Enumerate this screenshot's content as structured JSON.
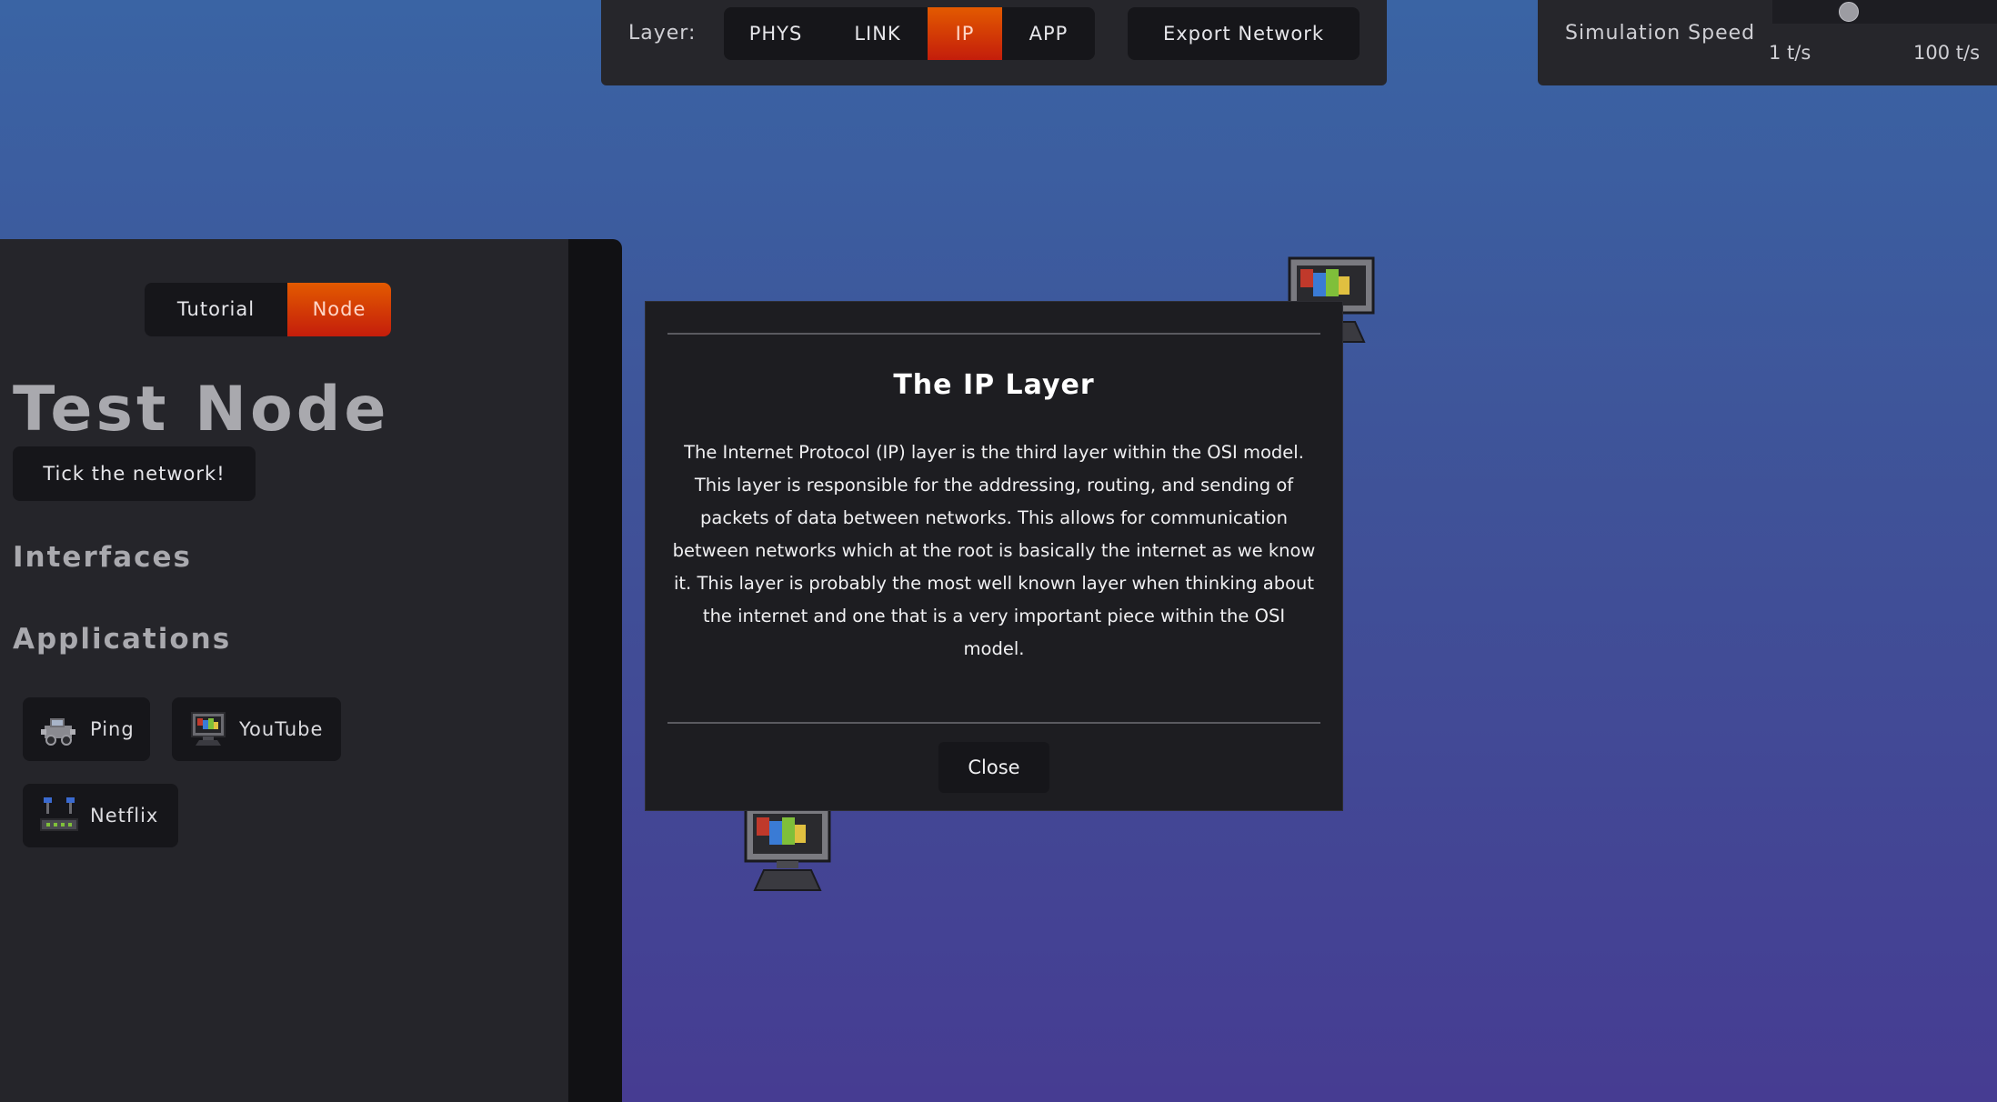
{
  "layer_bar": {
    "label": "Layer:",
    "layers": [
      {
        "label": "PHYS",
        "active": false
      },
      {
        "label": "LINK",
        "active": false
      },
      {
        "label": "IP",
        "active": true
      },
      {
        "label": "APP",
        "active": false
      }
    ],
    "export_label": "Export Network"
  },
  "speed": {
    "title": "Simulation Speed",
    "min_label": "1 t/s",
    "max_label": "100 t/s",
    "value_fraction": 0.34
  },
  "sidebar": {
    "tabs": [
      {
        "label": "Tutorial",
        "active": false
      },
      {
        "label": "Node",
        "active": true
      }
    ],
    "node_title": "Test Node",
    "tick_label": "Tick the network!",
    "interfaces_heading": "Interfaces",
    "applications_heading": "Applications",
    "applications": [
      {
        "label": "Ping",
        "icon": "ping-car-icon"
      },
      {
        "label": "YouTube",
        "icon": "monitor-icon"
      },
      {
        "label": "Netflix",
        "icon": "router-icon"
      }
    ]
  },
  "modal": {
    "title": "The IP Layer",
    "body": "The Internet Protocol (IP) layer is the third layer within the OSI model. This layer is responsible for the addressing, routing, and sending of packets of data between networks. This allows for communication between networks which at the root is basically the internet as we know it. This layer is probably the most well known layer when thinking about the internet and one that is a very important piece within the OSI model.",
    "close_label": "Close"
  },
  "colors": {
    "accent_start": "#e35a00",
    "accent_end": "#c41d0b",
    "panel": "#26262b",
    "button": "#16161a",
    "cable": "#c23aa8"
  }
}
